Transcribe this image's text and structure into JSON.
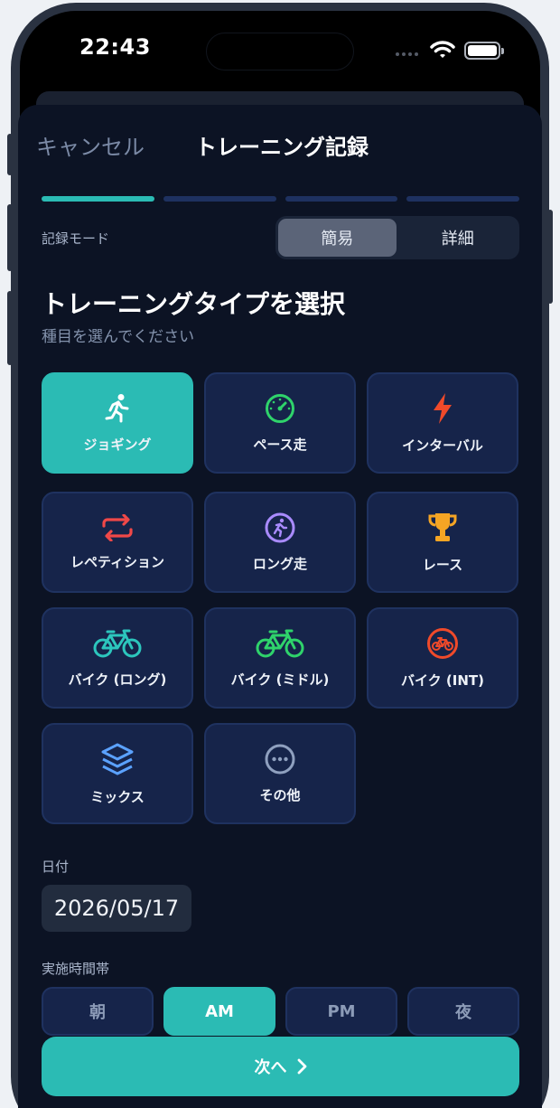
{
  "status_bar": {
    "time": "22:43"
  },
  "header": {
    "cancel_label": "キャンセル",
    "title": "トレーニング記録"
  },
  "progress": {
    "total_steps": 4,
    "current_step": 1
  },
  "mode": {
    "label": "記録モード",
    "options": [
      "簡易",
      "詳細"
    ],
    "selected": "簡易"
  },
  "section": {
    "title": "トレーニングタイプを選択",
    "subtitle": "種目を選んでください"
  },
  "training_types": [
    {
      "label": "ジョギング",
      "icon": "running-person-icon",
      "selected": true,
      "color": "#ffffff"
    },
    {
      "label": "ペース走",
      "icon": "stopwatch-icon",
      "selected": false,
      "color": "#2fd36b"
    },
    {
      "label": "インターバル",
      "icon": "lightning-icon",
      "selected": false,
      "color": "#f04a2a"
    },
    {
      "label": "レペティション",
      "icon": "repeat-icon",
      "selected": false,
      "color": "#f04848"
    },
    {
      "label": "ロング走",
      "icon": "runner-circle-icon",
      "selected": false,
      "color": "#a98bff"
    },
    {
      "label": "レース",
      "icon": "trophy-icon",
      "selected": false,
      "color": "#f5a524"
    },
    {
      "label": "バイク (ロング)",
      "icon": "bicycle-icon",
      "selected": false,
      "color": "#2cc6bd"
    },
    {
      "label": "バイク (ミドル)",
      "icon": "bicycle-icon",
      "selected": false,
      "color": "#2fd36b"
    },
    {
      "label": "バイク (INT)",
      "icon": "bicycle-circle-icon",
      "selected": false,
      "color": "#f04a2a"
    },
    {
      "label": "ミックス",
      "icon": "layers-icon",
      "selected": false,
      "color": "#5ba2ff"
    },
    {
      "label": "その他",
      "icon": "more-circle-icon",
      "selected": false,
      "color": "#8fa0bf"
    }
  ],
  "date": {
    "label": "日付",
    "value": "2026/05/17"
  },
  "time_of_day": {
    "label": "実施時間帯",
    "options": [
      "朝",
      "AM",
      "PM",
      "夜"
    ],
    "selected": "AM"
  },
  "next_button": {
    "label": "次へ"
  },
  "colors": {
    "accent": "#2bbbb4",
    "background": "#0c1324",
    "tile": "#16244a"
  }
}
